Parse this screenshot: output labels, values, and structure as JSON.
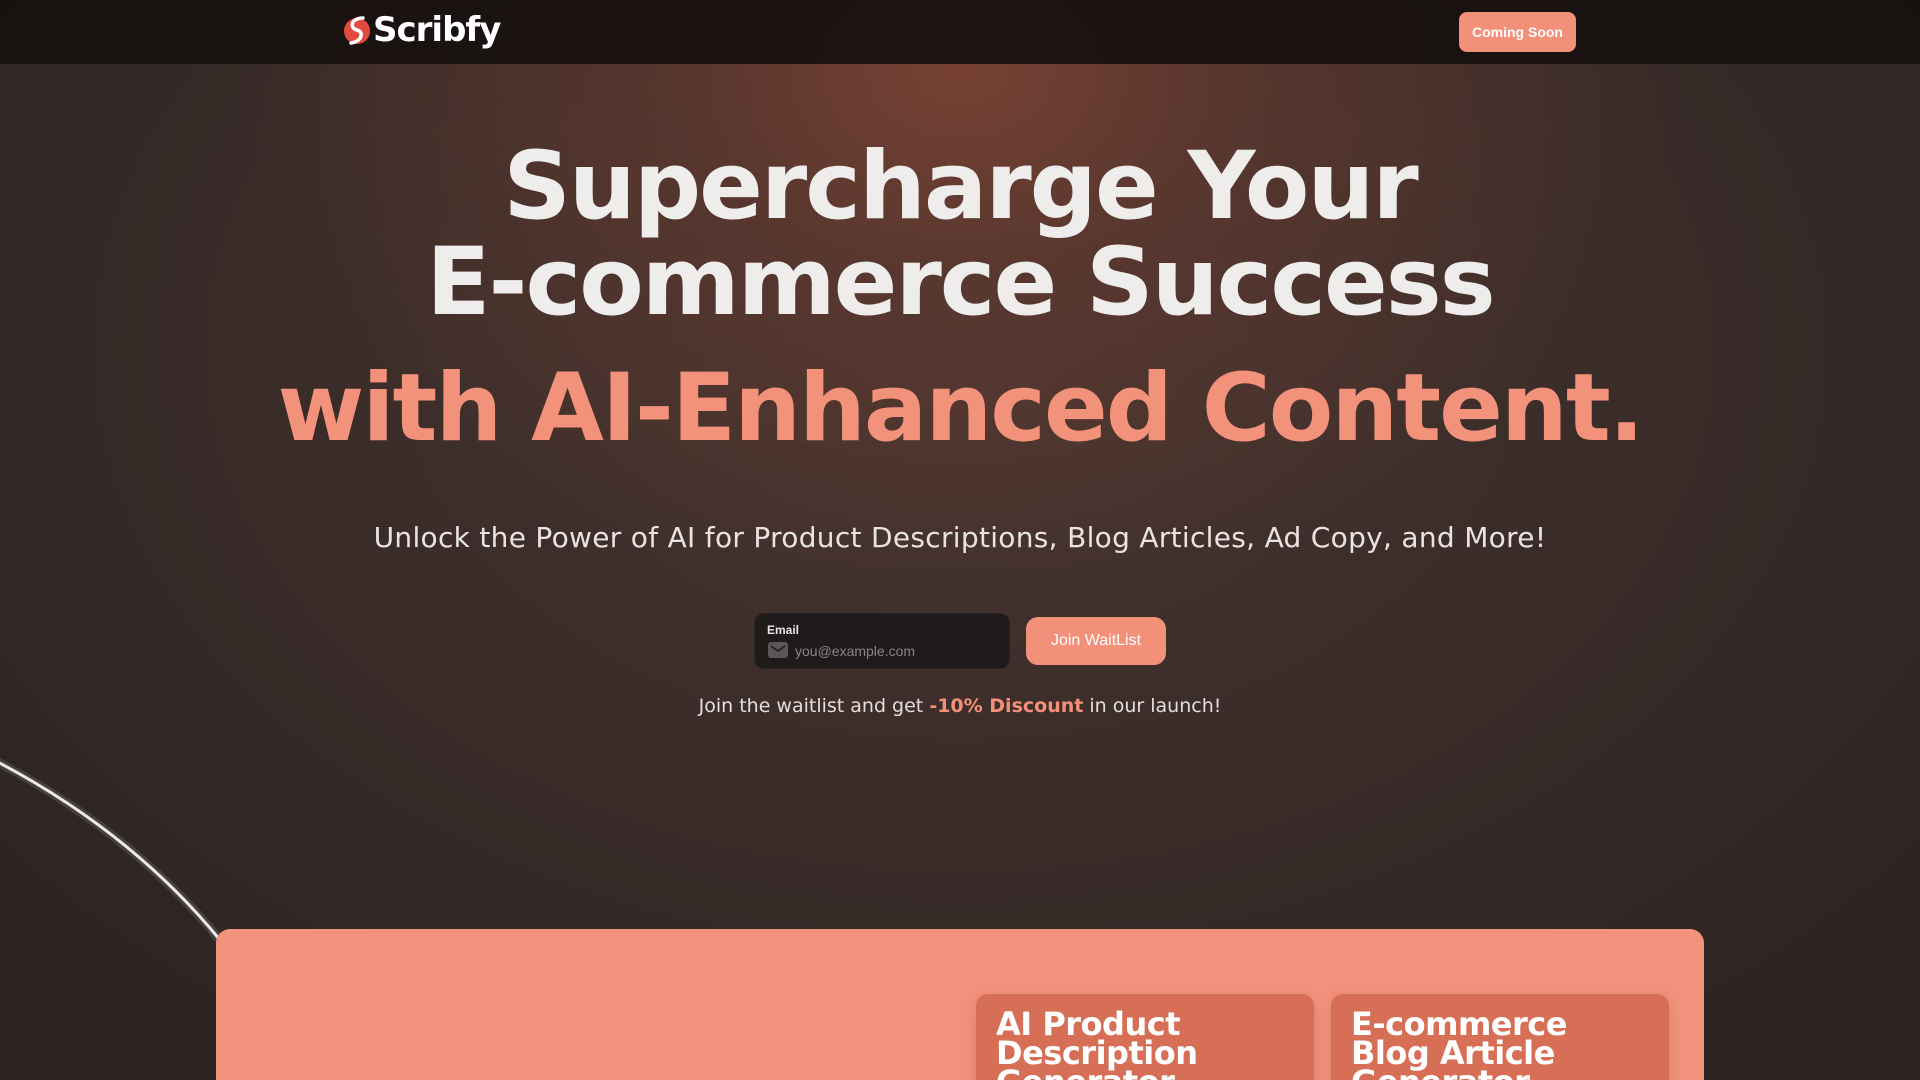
{
  "nav": {
    "brand": "Scribfy",
    "coming_soon_label": "Coming Soon"
  },
  "hero": {
    "title_line1": "Supercharge Your",
    "title_line2": "E-commerce Success",
    "title_line3": "with AI-Enhanced Content.",
    "subtitle": "Unlock the Power of AI for Product Descriptions, Blog Articles, Ad Copy, and More!"
  },
  "waitlist": {
    "email_label": "Email",
    "email_placeholder": "you@example.com",
    "email_value": "",
    "join_label": "Join WaitList",
    "note_prefix": "Join the waitlist and get ",
    "note_discount": "-10% Discount",
    "note_suffix": " in our launch!"
  },
  "features": {
    "cards": [
      {
        "title": "AI Product Description Generator"
      },
      {
        "title": "E-commerce Blog Article Generator"
      }
    ]
  },
  "colors": {
    "accent": "#f3907a",
    "nav_bg": "#16100f",
    "card_bg": "#d66f56",
    "panel_bg": "#f3927c"
  }
}
